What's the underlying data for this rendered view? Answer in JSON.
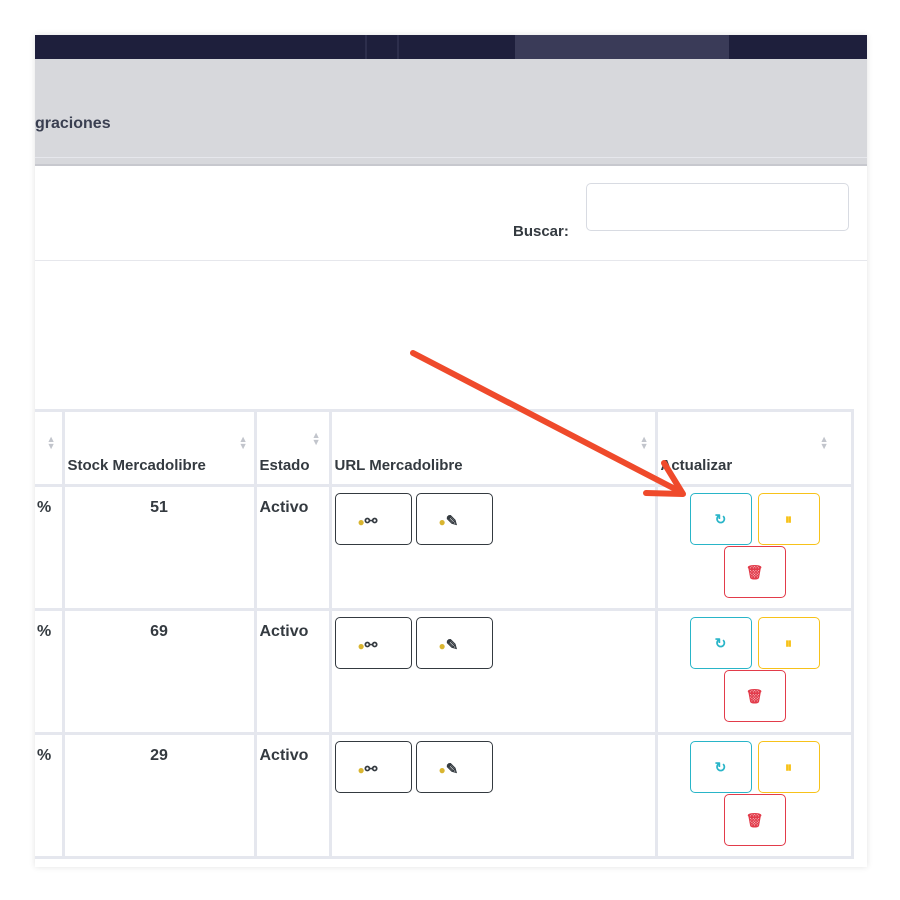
{
  "nav": {
    "tab_label": "graciones"
  },
  "search": {
    "label": "Buscar:",
    "value": ""
  },
  "table": {
    "headers": {
      "stock": "Stock Mercadolibre",
      "estado": "Estado",
      "url": "URL Mercadolibre",
      "actualizar": "Actualizar"
    },
    "rows": [
      {
        "pct": "%",
        "stock": "51",
        "estado": "Activo"
      },
      {
        "pct": "%",
        "stock": "69",
        "estado": "Activo"
      },
      {
        "pct": "%",
        "stock": "29",
        "estado": "Activo"
      }
    ]
  },
  "icons": {
    "link_button": "coin-link-icon",
    "edit_button": "coin-pencil-icon",
    "refresh": "refresh-icon",
    "pause": "pause-icon",
    "delete": "trash-icon",
    "sort": "sort-icon"
  },
  "colors": {
    "topbar": "#1e1f3c",
    "navbar": "#d7d8dc",
    "refresh": "#29b5c8",
    "pause": "#f7c21a",
    "delete": "#e23b4a",
    "arrow": "#ef4a2b"
  }
}
